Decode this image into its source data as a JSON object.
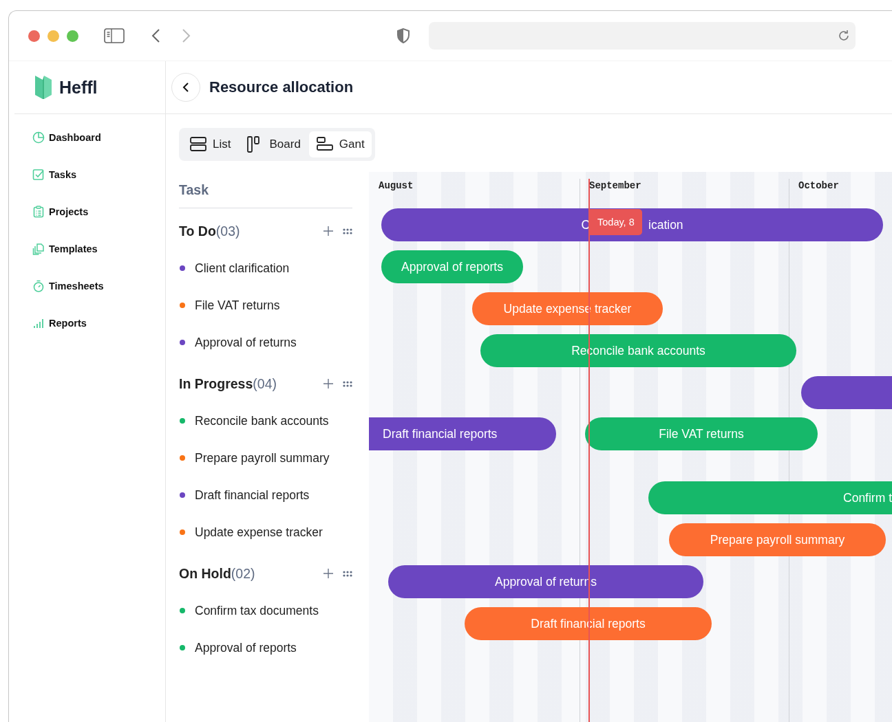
{
  "app": {
    "name": "Heffl"
  },
  "nav": [
    {
      "label": "Dashboard"
    },
    {
      "label": "Tasks"
    },
    {
      "label": "Projects"
    },
    {
      "label": "Templates"
    },
    {
      "label": "Timesheets"
    },
    {
      "label": "Reports"
    }
  ],
  "page": {
    "title": "Resource allocation"
  },
  "views": [
    {
      "label": "List",
      "selected": false
    },
    {
      "label": "Board",
      "selected": false
    },
    {
      "label": "Gant",
      "selected": true
    }
  ],
  "task_column": {
    "title": "Task"
  },
  "groups": [
    {
      "name": "To Do",
      "count": "(03)",
      "tasks": [
        {
          "label": "Client clarification",
          "color": "#6b46c1"
        },
        {
          "label": "File VAT returns",
          "color": "#f97316"
        },
        {
          "label": "Approval of returns",
          "color": "#6b46c1"
        }
      ]
    },
    {
      "name": "In Progress",
      "count": "(04)",
      "tasks": [
        {
          "label": "Reconcile bank accounts",
          "color": "#16b86a"
        },
        {
          "label": "Prepare payroll summary",
          "color": "#f97316"
        },
        {
          "label": "Draft financial reports",
          "color": "#6b46c1"
        },
        {
          "label": "Update expense tracker",
          "color": "#f97316"
        }
      ]
    },
    {
      "name": "On Hold",
      "count": "(02)",
      "tasks": [
        {
          "label": "Confirm tax documents",
          "color": "#16b86a"
        },
        {
          "label": "Approval of reports",
          "color": "#16b86a"
        }
      ]
    }
  ],
  "timeline": {
    "months": [
      {
        "label": "August"
      },
      {
        "label": "September"
      },
      {
        "label": "October"
      }
    ],
    "today": {
      "label": "Today, 8"
    },
    "rows": [
      {
        "bars": [
          {
            "label_parts": [
              "C",
              "ication"
            ],
            "color": "#6b46c1"
          }
        ]
      },
      {
        "bars": [
          {
            "label": "Approval of reports",
            "color": "#16b86a"
          }
        ]
      },
      {
        "bars": [
          {
            "label": "Update expense tracker",
            "color": "#fd6d31"
          }
        ]
      },
      {
        "bars": [
          {
            "label": "Reconcile bank accounts",
            "color": "#16b86a"
          }
        ]
      },
      {
        "bars": [
          {
            "color": "#6b46c1"
          }
        ]
      },
      {
        "bars": [
          {
            "label": "Draft financial reports",
            "color": "#6b46c1"
          },
          {
            "label": "File VAT returns",
            "color": "#16b86a"
          }
        ]
      },
      {
        "bars": [
          {
            "label": "Confirm t",
            "color": "#16b86a"
          }
        ]
      },
      {
        "bars": [
          {
            "label": "Prepare payroll summary",
            "color": "#fd6d31"
          }
        ]
      },
      {
        "bars": [
          {
            "label": "Approval of returns",
            "color": "#6b46c1"
          }
        ]
      },
      {
        "bars": [
          {
            "label": "Draft financial reports",
            "color": "#fd6d31"
          }
        ]
      }
    ]
  }
}
